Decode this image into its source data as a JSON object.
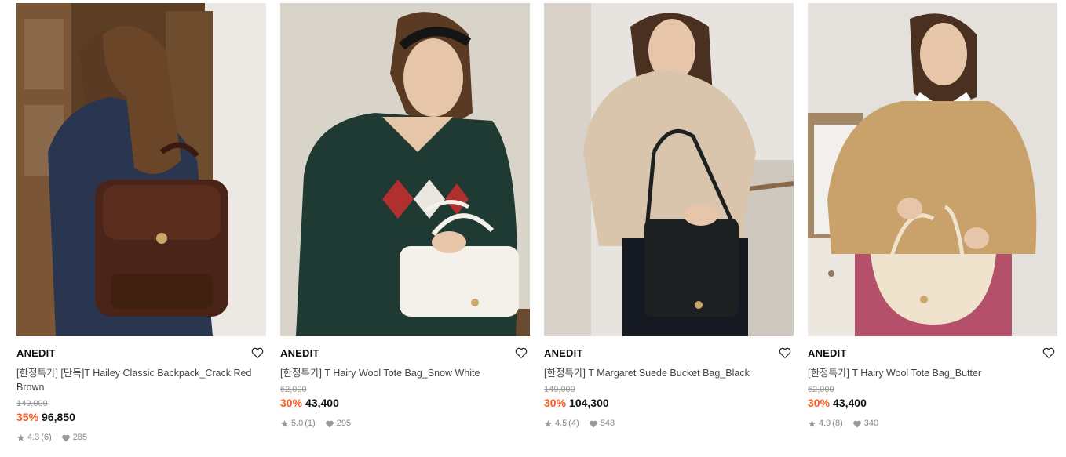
{
  "products": [
    {
      "brand": "ANEDIT",
      "name": "[한정특가] [단독]T Hailey Classic Backpack_Crack Red Brown",
      "original_price": "149,000",
      "discount": "35%",
      "price": "96,850",
      "rating": "4.3",
      "reviews": "(6)",
      "likes": "285",
      "image": {
        "background": "#6b4a2d",
        "bag_color": "#4a2418",
        "outfit_color": "#2a3550",
        "accent": "#c9a86a"
      }
    },
    {
      "brand": "ANEDIT",
      "name": "[한정특가] T Hairy Wool Tote Bag_Snow White",
      "original_price": "62,000",
      "discount": "30%",
      "price": "43,400",
      "rating": "5.0",
      "reviews": "(1)",
      "likes": "295",
      "image": {
        "background": "#d9d4ca",
        "bag_color": "#f4f1ea",
        "outfit_color": "#1f3a33",
        "accent": "#b03030"
      }
    },
    {
      "brand": "ANEDIT",
      "name": "[한정특가] T Margaret Suede Bucket Bag_Black",
      "original_price": "149,000",
      "discount": "30%",
      "price": "104,300",
      "rating": "4.5",
      "reviews": "(4)",
      "likes": "548",
      "image": {
        "background": "#e7e3de",
        "bag_color": "#1d2021",
        "outfit_color": "#d9c4ac",
        "accent": "#c9a86a"
      }
    },
    {
      "brand": "ANEDIT",
      "name": "[한정특가] T Hairy Wool Tote Bag_Butter",
      "original_price": "62,000",
      "discount": "30%",
      "price": "43,400",
      "rating": "4.9",
      "reviews": "(8)",
      "likes": "340",
      "image": {
        "background": "#e4e1dc",
        "bag_color": "#efe3cd",
        "outfit_color": "#c9a16a",
        "accent": "#b5506a"
      }
    }
  ],
  "icons": {
    "wishlist": "heart-outline-icon",
    "rating": "star-icon",
    "likes": "heart-filled-icon"
  },
  "colors": {
    "discount": "#ff5a1f",
    "muted": "#999999"
  }
}
